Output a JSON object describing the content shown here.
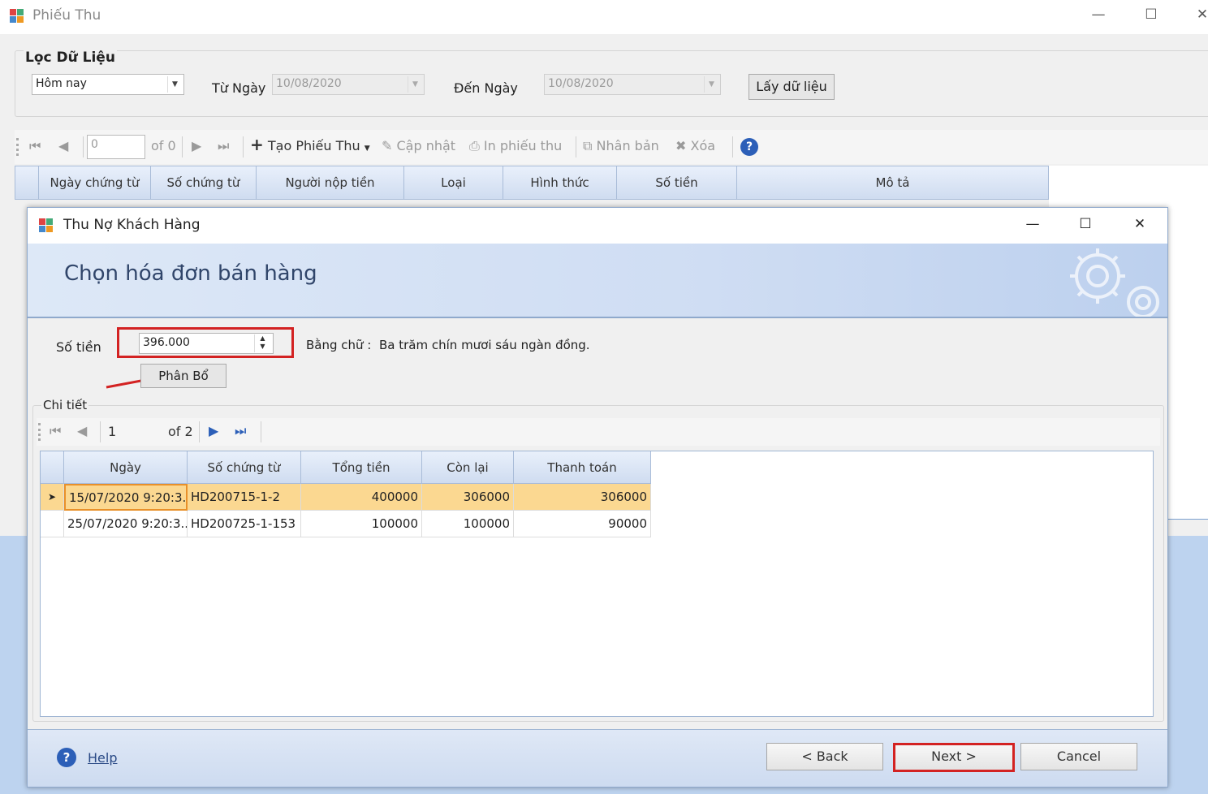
{
  "outer": {
    "title": "Phiếu Thu",
    "filter": {
      "legend": "Lọc Dữ Liệu",
      "period": "Hôm nay",
      "from_label": "Từ Ngày",
      "from_value": "10/08/2020",
      "to_label": "Đến Ngày",
      "to_value": "10/08/2020",
      "fetch_button": "Lấy dữ liệu"
    },
    "toolbar": {
      "position": "0",
      "of_label": "of 0",
      "create": "Tạo Phiếu Thu",
      "update": "Cập nhật",
      "print": "In phiếu thu",
      "duplicate": "Nhân bản",
      "delete": "Xóa"
    },
    "grid_columns": [
      "Ngày chứng từ",
      "Số chứng từ",
      "Người nộp tiền",
      "Loại",
      "Hình thức",
      "Số tiền",
      "Mô tả"
    ]
  },
  "dialog": {
    "title": "Thu Nợ Khách Hàng",
    "banner_title": "Chọn hóa đơn bán hàng",
    "amount_label": "Số tiền",
    "amount_value": "396.000",
    "words_label": "Bằng chữ :",
    "words_value": "Ba trăm chín mươi sáu ngàn đồng.",
    "allocate_button": "Phân Bổ",
    "detail_legend": "Chi tiết",
    "nav": {
      "position": "1",
      "of_label": "of 2"
    },
    "columns": [
      "Ngày",
      "Số chứng từ",
      "Tổng tiền",
      "Còn lại",
      "Thanh toán"
    ],
    "rows": [
      {
        "date": "15/07/2020  9:20:3...",
        "doc": "HD200715-1-2",
        "total": "400000",
        "remaining": "306000",
        "payment": "306000",
        "selected": true
      },
      {
        "date": "25/07/2020  9:20:3...",
        "doc": "HD200725-1-153",
        "total": "100000",
        "remaining": "100000",
        "payment": "90000",
        "selected": false
      }
    ],
    "footer": {
      "help": "Help",
      "back": "<  Back",
      "next": "Next  >",
      "cancel": "Cancel"
    }
  },
  "colors": {
    "highlight_red": "#d32222",
    "selected_row": "#fbd891",
    "banner_text": "#30456a"
  }
}
